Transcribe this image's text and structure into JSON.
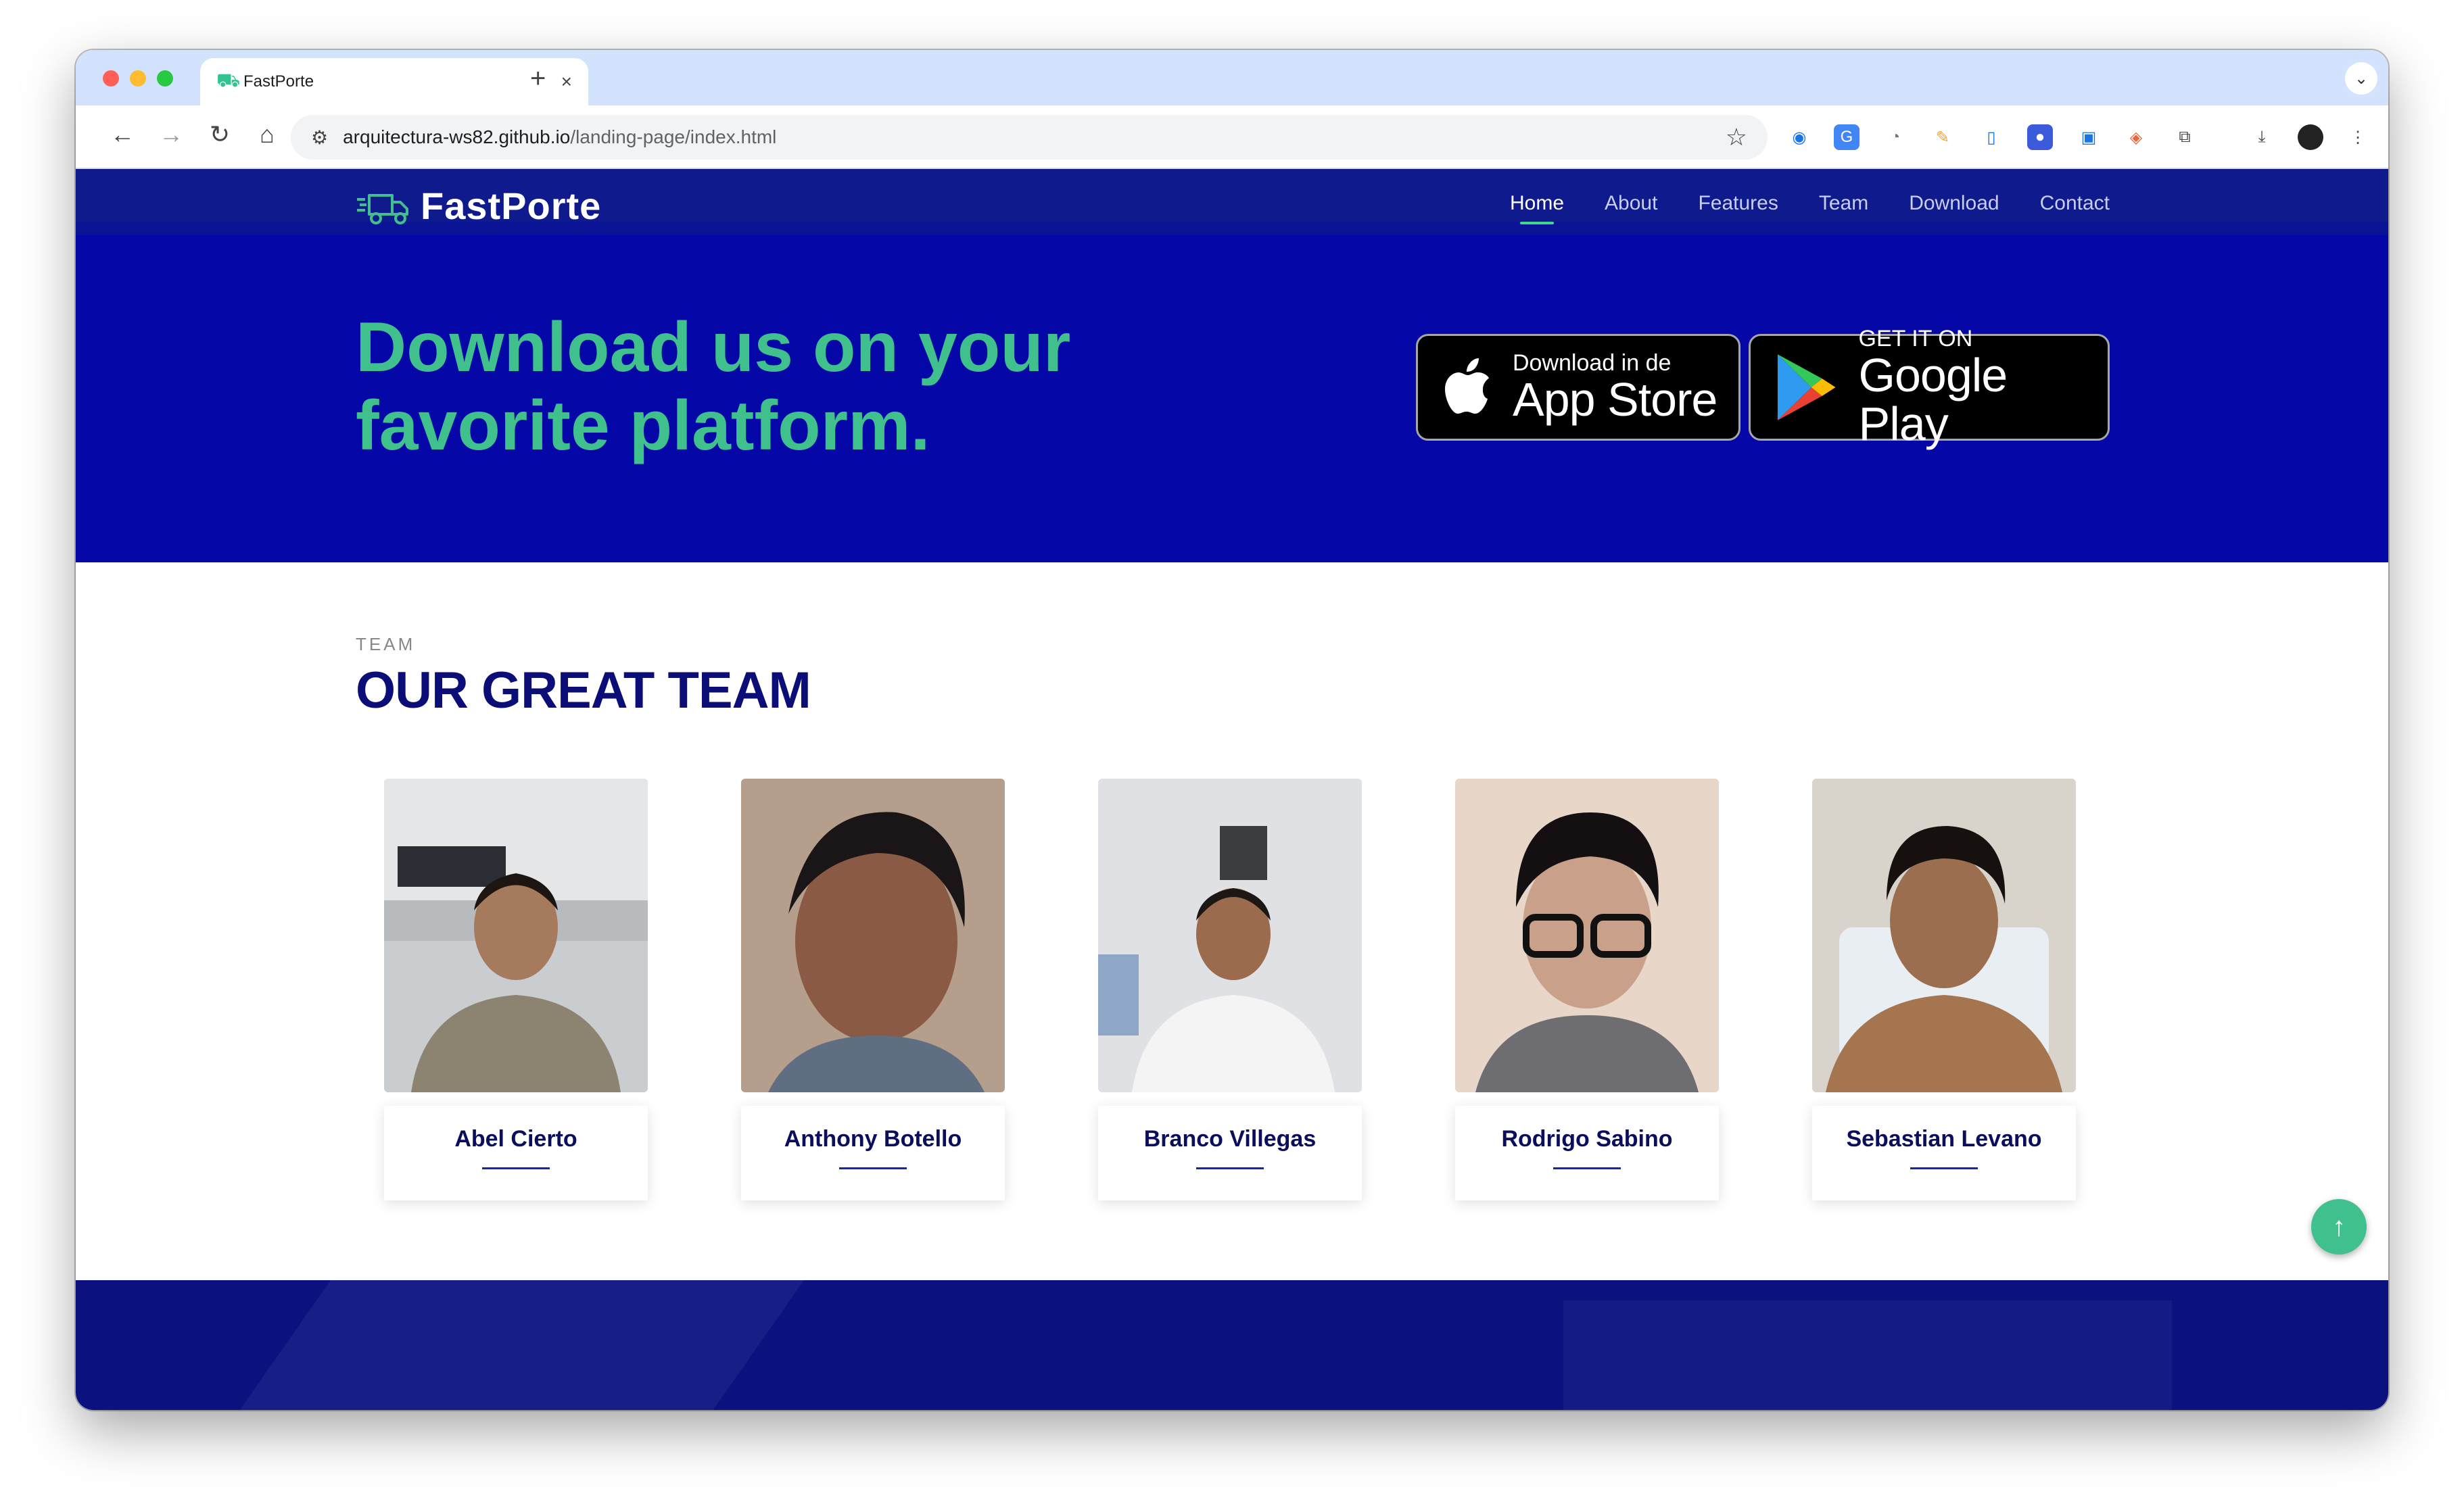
{
  "browser": {
    "tab_title": "FastPorte",
    "url_host": "arquitectura-ws82.github.io",
    "url_path": "/landing-page/index.html"
  },
  "site": {
    "brand": "FastPorte",
    "nav": [
      {
        "label": "Home",
        "active": true
      },
      {
        "label": "About",
        "active": false
      },
      {
        "label": "Features",
        "active": false
      },
      {
        "label": "Team",
        "active": false
      },
      {
        "label": "Download",
        "active": false
      },
      {
        "label": "Contact",
        "active": false
      }
    ]
  },
  "hero": {
    "headline_line1": "Download us on your",
    "headline_line2": "favorite platform.",
    "appstore_small": "Download in de",
    "appstore_big": "App Store",
    "googleplay_small": "GET IT ON",
    "googleplay_big": "Google Play"
  },
  "team": {
    "kicker": "TEAM",
    "title": "OUR GREAT TEAM",
    "members": [
      {
        "name": "Abel Cierto"
      },
      {
        "name": "Anthony Botello"
      },
      {
        "name": "Branco Villegas"
      },
      {
        "name": "Rodrigo Sabino"
      },
      {
        "name": "Sebastian Levano"
      }
    ]
  },
  "colors": {
    "navbar": "#0f1a8c",
    "hero_bg": "#0508a6",
    "accent_green": "#3fc08d",
    "title_navy": "#0a0e76"
  }
}
